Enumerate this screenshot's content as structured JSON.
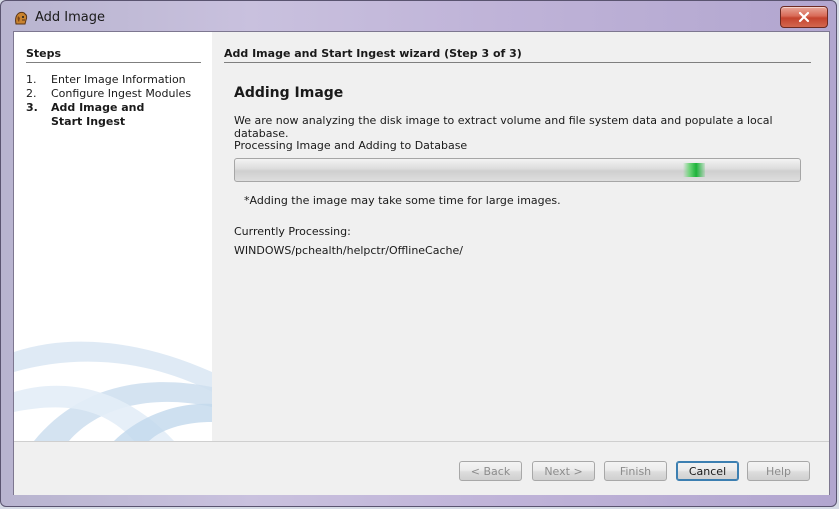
{
  "window": {
    "title": "Add Image",
    "icons": {
      "app": "dog-head-icon",
      "close": "close-icon"
    },
    "colors": {
      "frame": "#bfb3d8",
      "close": "#c4432e"
    }
  },
  "steps": {
    "header": "Steps",
    "items": [
      {
        "number": "1.",
        "label": "Enter Image Information"
      },
      {
        "number": "2.",
        "label": "Configure Ingest Modules"
      },
      {
        "number": "3.",
        "label": "Add Image and Start Ingest"
      }
    ],
    "active_index": 2
  },
  "wizard": {
    "header": "Add Image and Start Ingest wizard (Step 3 of 3)",
    "content_title": "Adding Image",
    "description": "We are now analyzing the disk image to extract volume and file system data and populate a local database.",
    "progress_label": "Processing Image and Adding to Database",
    "progress_state": "indeterminate",
    "progress_color": "#1db33a",
    "note": "*Adding the image may take some time for large images.",
    "currently_processing_label": "Currently Processing:",
    "current_path": "WINDOWS/pchealth/helpctr/OfflineCache/"
  },
  "buttons": {
    "back": "< Back",
    "next": "Next >",
    "finish": "Finish",
    "cancel": "Cancel",
    "help": "Help"
  }
}
